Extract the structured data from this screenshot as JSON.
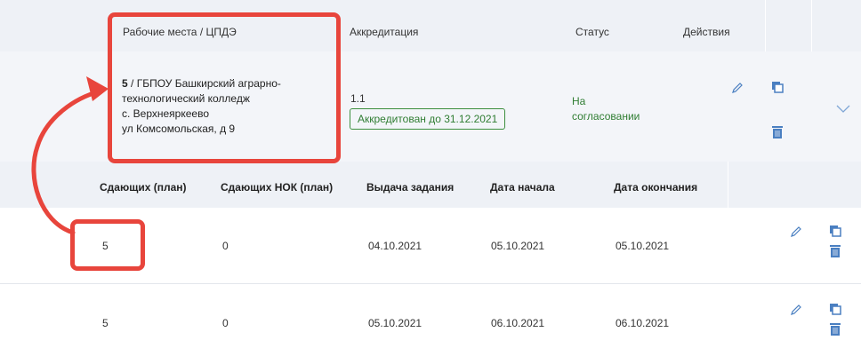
{
  "header": {
    "workplaces_label": "Рабочие места / ЦПДЭ",
    "accreditation_label": "Аккредитация",
    "status_label": "Статус",
    "actions_label": "Действия"
  },
  "workplace": {
    "count": "5",
    "line1": " / ГБПОУ Башкирский аграрно-",
    "line2": "технологический колледж",
    "line3": "с. Верхнеяркеево",
    "line4": "ул Комсомольская, д 9"
  },
  "accreditation": {
    "number": "1.1",
    "badge": "Аккредитован до 31.12.2021"
  },
  "status": {
    "line1": "На",
    "line2": "согласовании"
  },
  "sub_header": {
    "plan_label": "Сдающих (план)",
    "nok_label": "Сдающих НОК (план)",
    "issue_label": "Выдача задания",
    "start_label": "Дата начала",
    "end_label": "Дата окончания"
  },
  "rows": [
    {
      "plan": "5",
      "nok": "0",
      "issue": "04.10.2021",
      "start": "05.10.2021",
      "end": "05.10.2021"
    },
    {
      "plan": "5",
      "nok": "0",
      "issue": "05.10.2021",
      "start": "06.10.2021",
      "end": "06.10.2021"
    }
  ],
  "colors": {
    "accent_green": "#2f7d32",
    "icon_blue": "#4a7fc1",
    "annotation_red": "#e8453c",
    "header_bg": "#eef1f6"
  },
  "icons": [
    "pencil-icon",
    "copy-icon",
    "trash-icon",
    "chevron-down-icon"
  ]
}
